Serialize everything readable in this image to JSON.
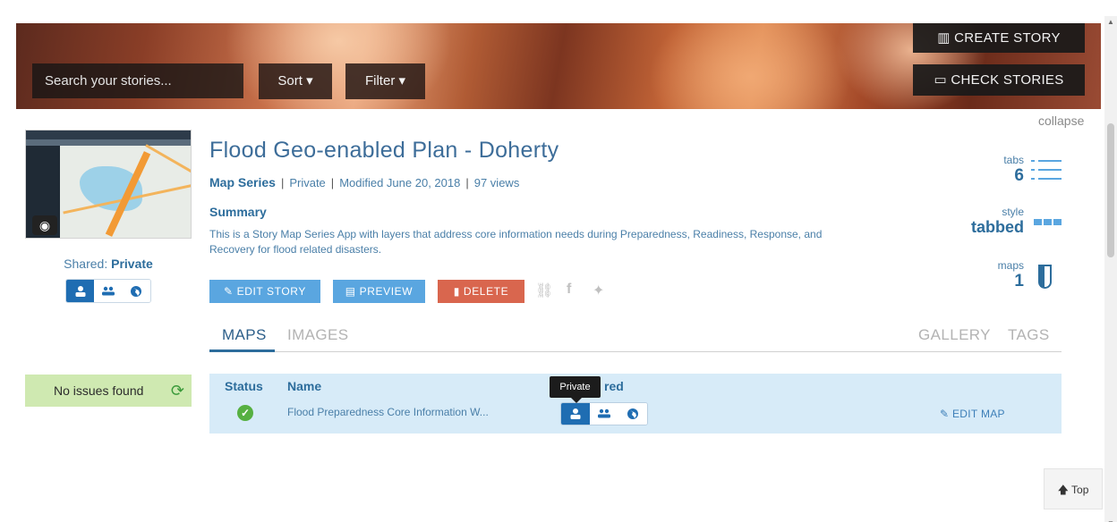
{
  "header": {
    "search_placeholder": "Search your stories...",
    "sort_label": "Sort ▾",
    "filter_label": "Filter ▾",
    "create_story_label": "CREATE STORY",
    "check_stories_label": "CHECK STORIES"
  },
  "collapse_label": "collapse",
  "left": {
    "shared_prefix": "Shared: ",
    "shared_value": "Private",
    "issues_label": "No issues found"
  },
  "story": {
    "title": "Flood Geo-enabled Plan - Doherty",
    "type": "Map Series",
    "privacy": "Private",
    "modified": "Modified June 20, 2018",
    "views": "97 views",
    "summary_heading": "Summary",
    "summary_text": "This is a Story Map Series App with layers that address core information needs during Preparedness, Readiness, Response, and Recovery for flood related disasters."
  },
  "actions": {
    "edit_story": "EDIT STORY",
    "preview": "PREVIEW",
    "delete": "DELETE"
  },
  "stats": {
    "tabs_label": "tabs",
    "tabs_value": "6",
    "style_label": "style",
    "style_value": "tabbed",
    "maps_label": "maps",
    "maps_value": "1"
  },
  "tabs": {
    "maps": "MAPS",
    "images": "IMAGES",
    "gallery": "GALLERY",
    "tags": "TAGS"
  },
  "table": {
    "headers": {
      "status": "Status",
      "name": "Name",
      "shared": "red"
    },
    "rows": [
      {
        "name": "Flood Preparedness Core Information W...",
        "edit_label": "EDIT MAP"
      }
    ]
  },
  "tooltip": "Private",
  "top_label": "Top",
  "colors": {
    "accent": "#5aa6e0",
    "primary_text": "#2d6d9c",
    "danger": "#d9664e",
    "success_bg": "#cfe9b1"
  }
}
